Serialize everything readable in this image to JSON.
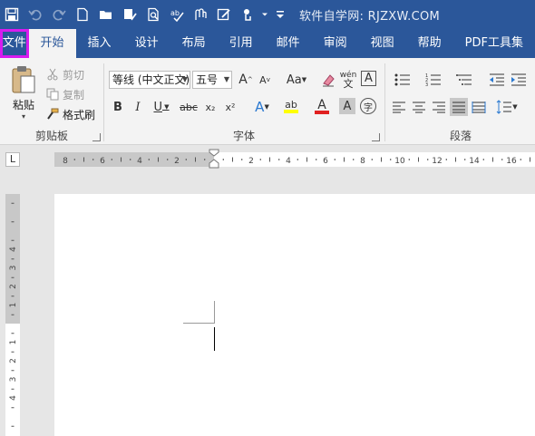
{
  "title_bar": {
    "site_text": "软件自学网: RJZXW.COM",
    "quick_access": [
      "save-icon",
      "undo-icon",
      "redo-icon",
      "new-document-icon",
      "open-folder-icon",
      "accessibility-check-icon",
      "print-preview-icon",
      "spelling-icon",
      "attach-icon",
      "edit-doc-icon",
      "touch-mode-icon",
      "customize-dropdown-icon"
    ]
  },
  "tabs": [
    "文件",
    "开始",
    "插入",
    "设计",
    "布局",
    "引用",
    "邮件",
    "审阅",
    "视图",
    "帮助",
    "PDF工具集"
  ],
  "ribbon": {
    "clipboard": {
      "label": "剪贴板",
      "paste": "粘贴",
      "cut": "剪切",
      "copy": "复制",
      "format_painter": "格式刷"
    },
    "font": {
      "label": "字体",
      "font_name": "等线 (中文正文)",
      "font_size": "五号",
      "grow": "A",
      "shrink": "A",
      "change_case": "Aa",
      "bold": "B",
      "italic": "I",
      "underline": "U",
      "strikethrough": "abc",
      "subscript": "x₂",
      "superscript": "x²",
      "phonetic": "wén",
      "border_char": "A",
      "shading_char": "A",
      "enclose_char": "字",
      "highlight": "ab",
      "font_color": "A"
    },
    "paragraph": {
      "label": "段落"
    }
  },
  "ruler": {
    "tab_selector": "L",
    "left_numbers": [
      "8",
      "6",
      "4",
      "2"
    ],
    "right_numbers": [
      "2",
      "4",
      "6",
      "8",
      "10",
      "12",
      "14",
      "16"
    ],
    "vertical_numbers": [
      "4",
      "3",
      "2",
      "1",
      "1",
      "2",
      "3",
      "4"
    ]
  },
  "colors": {
    "title_bg": "#2b579a",
    "ribbon_bg": "#f3f3f3",
    "highlight_border": "#d81bf0",
    "highlight_yellow": "#ffff00",
    "font_red": "#e02020"
  }
}
